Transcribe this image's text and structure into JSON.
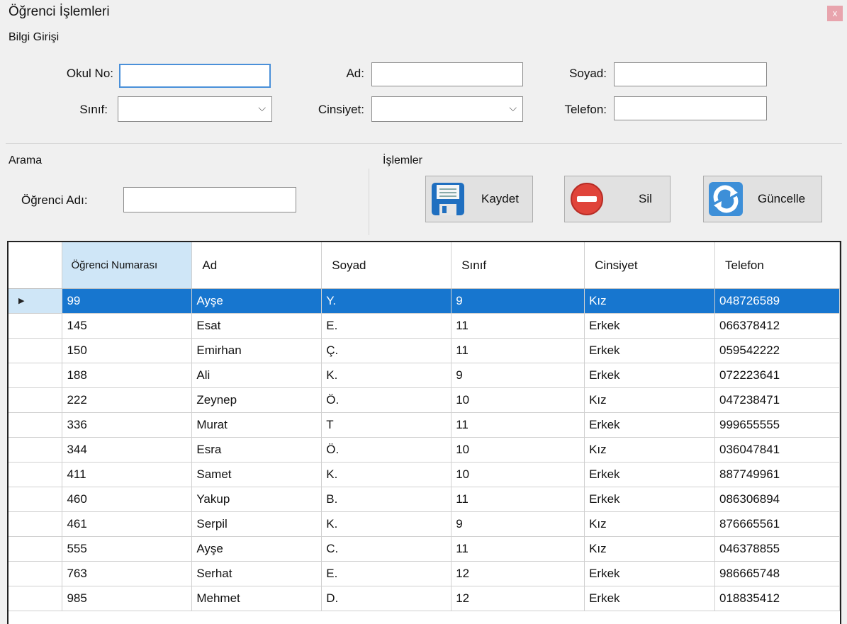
{
  "window": {
    "title": "Öğrenci İşlemleri",
    "close_label": "x"
  },
  "bilgi": {
    "group_label": "Bilgi Girişi",
    "okul_no_label": "Okul No:",
    "ad_label": "Ad:",
    "soyad_label": "Soyad:",
    "sinif_label": "Sınıf:",
    "cinsiyet_label": "Cinsiyet:",
    "telefon_label": "Telefon:",
    "okul_no_value": "",
    "ad_value": "",
    "soyad_value": "",
    "sinif_value": "",
    "cinsiyet_value": "",
    "telefon_value": ""
  },
  "arama": {
    "group_label": "Arama",
    "ogrenci_adi_label": "Öğrenci Adı:",
    "ogrenci_adi_value": ""
  },
  "islemler": {
    "group_label": "İşlemler",
    "kaydet": "Kaydet",
    "sil": "Sil",
    "guncelle": "Güncelle"
  },
  "grid": {
    "columns": [
      "Öğrenci Numarası",
      "Ad",
      "Soyad",
      "Sınıf",
      "Cinsiyet",
      "Telefon"
    ],
    "selected_row": 0,
    "rows": [
      [
        "99",
        "Ayşe",
        "Y.",
        "9",
        "Kız",
        "048726589"
      ],
      [
        "145",
        "Esat",
        "E.",
        "11",
        "Erkek",
        "066378412"
      ],
      [
        "150",
        "Emirhan",
        "Ç.",
        "11",
        "Erkek",
        "059542222"
      ],
      [
        "188",
        "Ali",
        "K.",
        "9",
        "Erkek",
        "072223641"
      ],
      [
        "222",
        "Zeynep",
        "Ö.",
        "10",
        "Kız",
        "047238471"
      ],
      [
        "336",
        "Murat",
        "T",
        "11",
        "Erkek",
        "999655555"
      ],
      [
        "344",
        "Esra",
        "Ö.",
        "10",
        "Kız",
        "036047841"
      ],
      [
        "411",
        "Samet",
        "K.",
        "10",
        "Erkek",
        "887749961"
      ],
      [
        "460",
        "Yakup",
        "B.",
        "11",
        "Erkek",
        "086306894"
      ],
      [
        "461",
        "Serpil",
        "K.",
        "9",
        "Kız",
        "876665561"
      ],
      [
        "555",
        "Ayşe",
        "C.",
        "11",
        "Kız",
        "046378855"
      ],
      [
        "763",
        "Serhat",
        "E.",
        "12",
        "Erkek",
        "986665748"
      ],
      [
        "985",
        "Mehmet",
        "D.",
        "12",
        "Erkek",
        "018835412"
      ]
    ]
  },
  "colors": {
    "selection": "#1776cf",
    "header_highlight": "#cfe6f7",
    "close": "#e8a4ad"
  },
  "icons": {
    "kaydet": "floppy-disk-icon",
    "sil": "delete-circle-icon",
    "guncelle": "refresh-icon",
    "combo": "chevron-down-icon"
  }
}
